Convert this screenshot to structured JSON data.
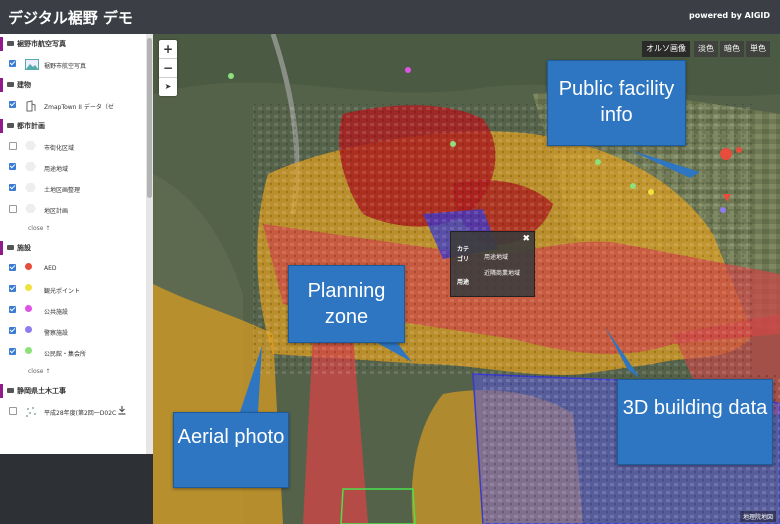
{
  "header": {
    "title": "デジタル裾野 デモ",
    "powered_by": "powered by AIGID"
  },
  "sidebar": {
    "sections": [
      {
        "label": "裾野市航空写真",
        "layers": [
          {
            "label": "裾野市航空写真",
            "checked": true,
            "symbol": "photo-icon"
          }
        ]
      },
      {
        "label": "建物",
        "layers": [
          {
            "label": "ZmapTown II データ（ゼ",
            "checked": true,
            "symbol": "building-icon"
          }
        ]
      },
      {
        "label": "都市計画",
        "layers": [
          {
            "label": "市街化区域",
            "checked": false,
            "symbol": "hexagon"
          },
          {
            "label": "用途地域",
            "checked": true,
            "symbol": "hexagon"
          },
          {
            "label": "土地区画整理",
            "checked": true,
            "symbol": "hexagon"
          },
          {
            "label": "地区計画",
            "checked": false,
            "symbol": "hexagon"
          }
        ],
        "close_label": "close ↑"
      },
      {
        "label": "施設",
        "layers": [
          {
            "label": "AED",
            "checked": true,
            "color": "#e74c3c"
          },
          {
            "label": "観光ポイント",
            "checked": true,
            "color": "#f1e23b"
          },
          {
            "label": "公共施設",
            "checked": true,
            "color": "#e052e6"
          },
          {
            "label": "警察施設",
            "checked": true,
            "color": "#8f7bf0"
          },
          {
            "label": "公民館・集会所",
            "checked": true,
            "color": "#8ee07a"
          }
        ],
        "close_label": "close ↑"
      },
      {
        "label": "静岡県土木工事",
        "layers": [
          {
            "label": "平成28年度(第2回一D02C",
            "checked": false,
            "symbol": "dots-icon"
          }
        ]
      }
    ]
  },
  "map": {
    "zoom_in": "+",
    "zoom_out": "−",
    "compass": "➤",
    "basemaps": [
      "オルソ画像",
      "淡色",
      "暗色",
      "単色"
    ],
    "active_basemap": "オルソ画像",
    "popup": {
      "close": "✖",
      "category_key": "カテゴリ",
      "category_value": "用途地域",
      "use_key": "用途",
      "use_value": "近隣商業地域"
    },
    "attribution": "地理院地図"
  },
  "callouts": {
    "public_facility": "Public facility info",
    "planning_zone": "Planning zone",
    "building_data": "3D building data",
    "aerial_photo": "Aerial photo"
  },
  "colors": {
    "header": "#3b3f45",
    "callout": "#2e76c1",
    "accent": "#8e1c8a",
    "commercial_zone": "#c0392b",
    "residential_zone": "#e0a020",
    "industrial_zone": "#3a3ad0"
  }
}
